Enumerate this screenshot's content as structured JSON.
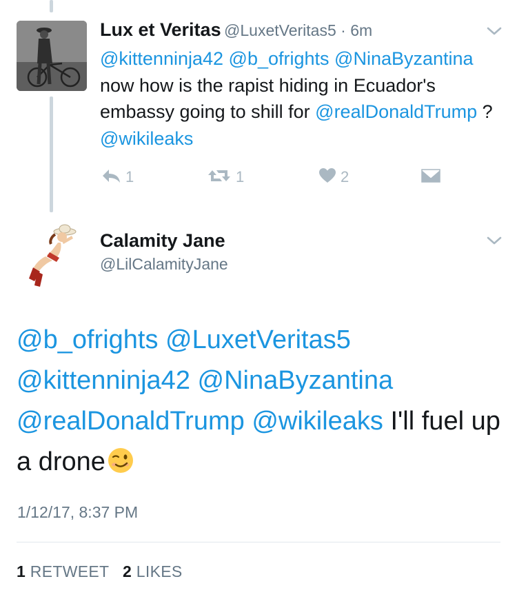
{
  "reply_tweet": {
    "display_name": "Lux et Veritas",
    "handle": "@LuxetVeritas5",
    "separator": " · ",
    "time_ago": "6m",
    "text_parts": [
      {
        "text": "@kittenninja42",
        "mention": true
      },
      {
        "text": " ",
        "mention": false
      },
      {
        "text": "@b_ofrights",
        "mention": true
      },
      {
        "text": " ",
        "mention": false
      },
      {
        "text": "@NinaByzantina",
        "mention": true
      },
      {
        "text": " now how is the rapist hiding in Ecuador's embassy going to shill for ",
        "mention": false
      },
      {
        "text": "@realDonaldTrump",
        "mention": true
      },
      {
        "text": " ? ",
        "mention": false
      },
      {
        "text": "@wikileaks",
        "mention": true
      }
    ],
    "actions": {
      "reply_count": "1",
      "retweet_count": "1",
      "like_count": "2"
    },
    "icons": [
      "reply-icon",
      "retweet-icon",
      "heart-icon",
      "direct-message-icon",
      "chevron-down-icon"
    ]
  },
  "main_tweet": {
    "display_name": "Calamity Jane",
    "handle": "@LilCalamityJane",
    "text_parts": [
      {
        "text": "@b_ofrights",
        "mention": true
      },
      {
        "text": " ",
        "mention": false
      },
      {
        "text": "@LuxetVeritas5",
        "mention": true
      },
      {
        "text": " ",
        "mention": false
      },
      {
        "text": "@kittenninja42",
        "mention": true
      },
      {
        "text": " ",
        "mention": false
      },
      {
        "text": "@NinaByzantina",
        "mention": true
      },
      {
        "text": " ",
        "mention": false
      },
      {
        "text": "@realDonaldTrump",
        "mention": true
      },
      {
        "text": " ",
        "mention": false
      },
      {
        "text": "@wikileaks",
        "mention": true
      },
      {
        "text": " I'll fuel up a drone",
        "mention": false
      }
    ],
    "emoji": "winking-face-emoji",
    "timestamp": "1/12/17, 8:37 PM",
    "stats": {
      "retweet_count": "1",
      "retweet_label": "RETWEET",
      "like_count": "2",
      "like_label": "LIKES"
    }
  },
  "colors": {
    "mention": "#1b95e0",
    "secondary_text": "#657786",
    "action_icon": "#aab8c2",
    "thread_line": "#ccd6dd"
  }
}
